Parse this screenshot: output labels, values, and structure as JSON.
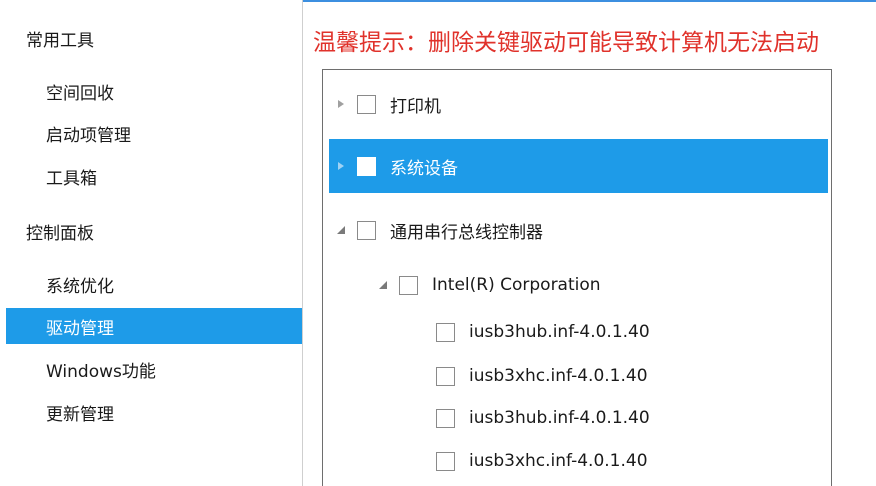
{
  "sidebar": {
    "sections": [
      {
        "label": "常用工具",
        "items": [
          "空间回收",
          "启动项管理",
          "工具箱"
        ]
      },
      {
        "label": "控制面板",
        "items": [
          "系统优化",
          "驱动管理",
          "Windows功能",
          "更新管理"
        ]
      }
    ],
    "selected": "驱动管理"
  },
  "warning": "温馨提示：删除关键驱动可能导致计算机无法启动",
  "tree": {
    "nodes": [
      {
        "label": "打印机",
        "expander": "collapsed",
        "checked": false
      },
      {
        "label": "系统设备",
        "expander": "collapsed",
        "checked": false,
        "selected": true
      },
      {
        "label": "通用串行总线控制器",
        "expander": "expanded",
        "checked": false
      },
      {
        "label": "Intel(R) Corporation",
        "expander": "expanded",
        "checked": false
      },
      {
        "label": "iusb3hub.inf-4.0.1.40",
        "checked": false
      },
      {
        "label": "iusb3xhc.inf-4.0.1.40",
        "checked": false
      },
      {
        "label": "iusb3hub.inf-4.0.1.40",
        "checked": false
      },
      {
        "label": "iusb3xhc.inf-4.0.1.40",
        "checked": false
      }
    ]
  },
  "colors": {
    "accent": "#1e9be8",
    "warning": "#e0322b",
    "panel_border": "#6e6e6e"
  }
}
